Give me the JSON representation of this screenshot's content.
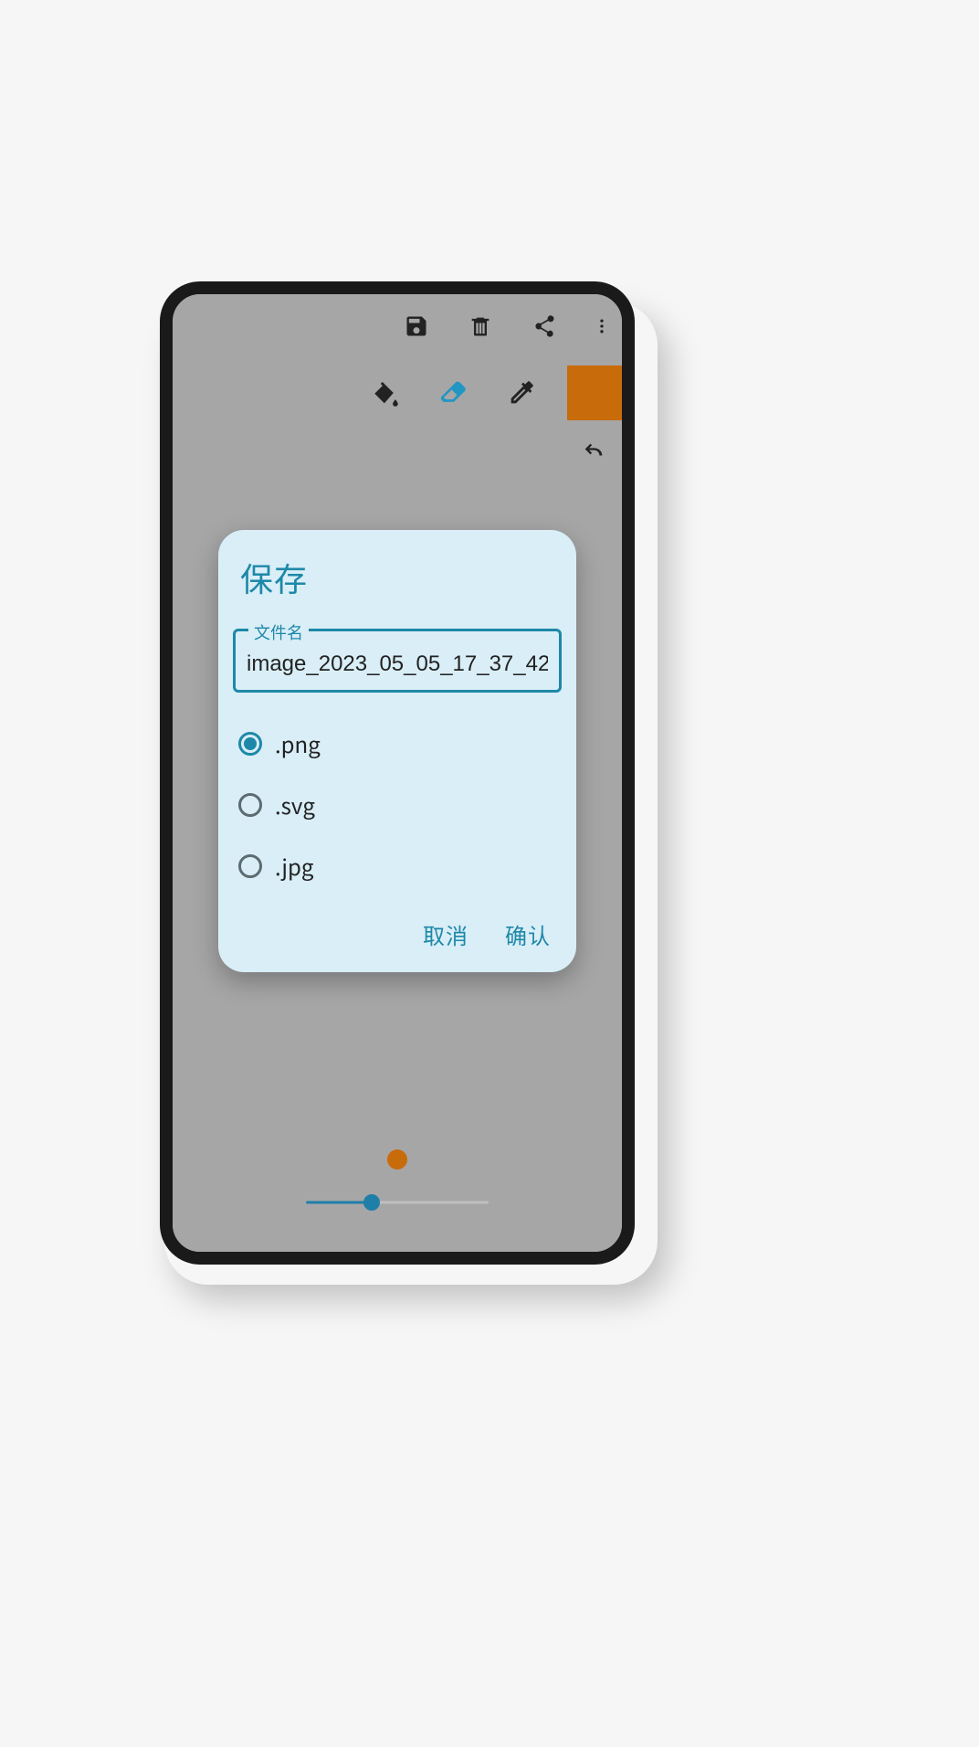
{
  "toolbar": {
    "save_icon": "save",
    "delete_icon": "delete",
    "share_icon": "share",
    "more_icon": "more"
  },
  "tools": {
    "fill_icon": "fill-bucket",
    "eraser_icon": "eraser",
    "eyedropper_icon": "eyedropper",
    "current_color": "#c86b0b",
    "undo_icon": "undo"
  },
  "dialog": {
    "title": "保存",
    "filename_label": "文件名",
    "filename_value": "image_2023_05_05_17_37_42",
    "formats": [
      {
        "label": ".png",
        "selected": true
      },
      {
        "label": ".svg",
        "selected": false
      },
      {
        "label": ".jpg",
        "selected": false
      }
    ],
    "cancel_label": "取消",
    "confirm_label": "确认"
  },
  "brush": {
    "preview_color": "#c86b0b",
    "slider_value_pct": 36
  }
}
